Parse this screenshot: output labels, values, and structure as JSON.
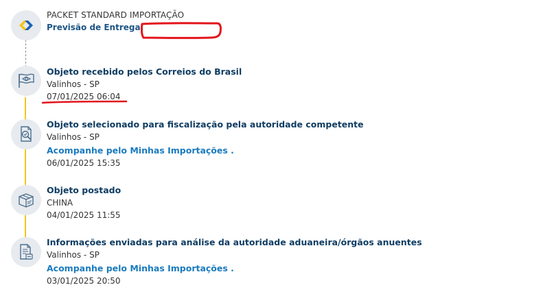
{
  "header": {
    "service_name": "PACKET STANDARD IMPORTAÇÃO",
    "forecast_label": "Previsão de Entrega:"
  },
  "events": [
    {
      "title": "Objeto recebido pelos Correios do Brasil",
      "location": "Valinhos - SP",
      "datetime": "07/01/2025 06:04",
      "link": null,
      "icon": "flag-icon"
    },
    {
      "title": "Objeto selecionado para fiscalização pela autoridade competente",
      "location": "Valinhos - SP",
      "link": "Acompanhe pelo Minhas Importações .",
      "datetime": "06/01/2025 15:35",
      "icon": "inspection-icon"
    },
    {
      "title": "Objeto postado",
      "location": "CHINA",
      "datetime": "04/01/2025 11:55",
      "link": null,
      "icon": "package-icon"
    },
    {
      "title": "Informações enviadas para análise da autoridade aduaneira/órgãos anuentes",
      "location": "Valinhos - SP",
      "link": "Acompanhe pelo Minhas Importações .",
      "datetime": "03/01/2025 20:50",
      "icon": "document-icon"
    }
  ],
  "colors": {
    "timeline_yellow": "#f6c517",
    "title_blue": "#0f3d63",
    "link_blue": "#1a7bbf",
    "annotation_red": "#e3141b",
    "icon_bg": "#e7eaee"
  }
}
